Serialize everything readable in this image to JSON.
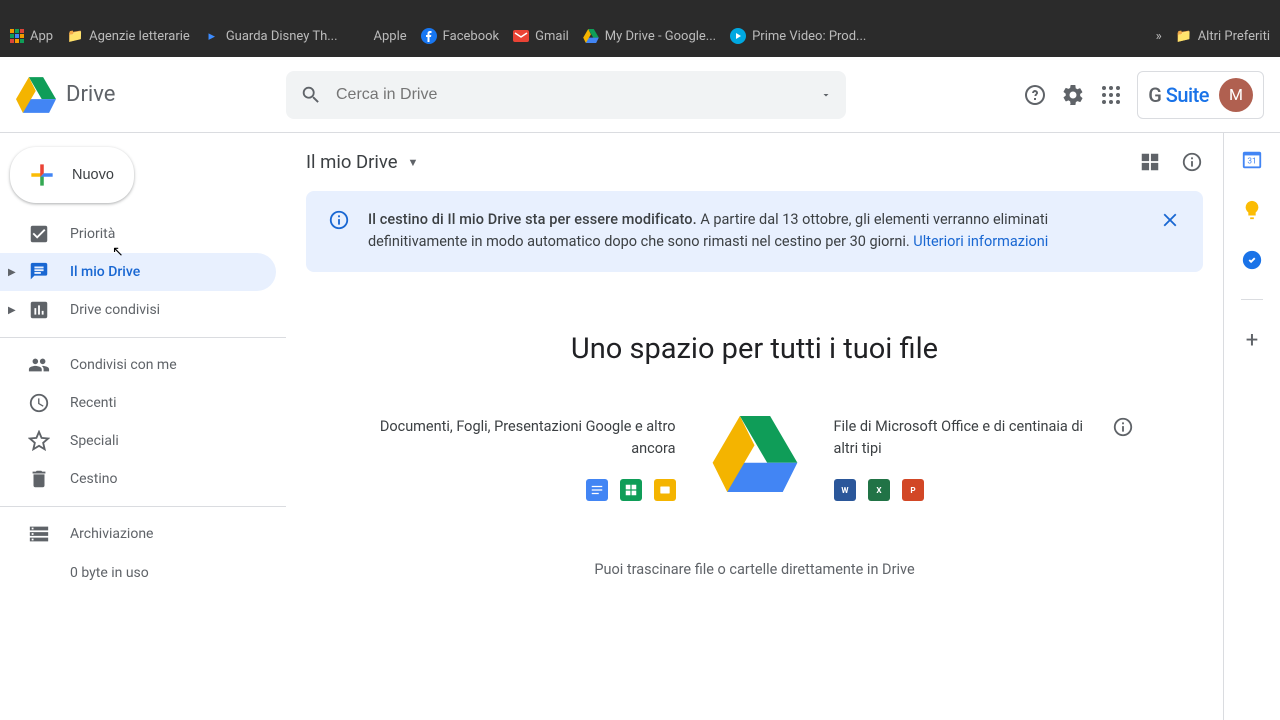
{
  "browser": {
    "bookmarks": [
      "App",
      "Agenzie letterarie",
      "Guarda Disney Th...",
      "Apple",
      "Facebook",
      "Gmail",
      "My Drive - Google...",
      "Prime Video: Prod..."
    ],
    "more": "»",
    "other": "Altri Preferiti"
  },
  "header": {
    "product": "Drive",
    "search_placeholder": "Cerca in Drive",
    "gsuite_g": "G",
    "gsuite_rest": " Suite",
    "avatar": "M"
  },
  "sidebar": {
    "new_label": "Nuovo",
    "items": {
      "priority": "Priorità",
      "mydrive": "Il mio Drive",
      "shared_drives": "Drive condivisi",
      "shared_with_me": "Condivisi con me",
      "recent": "Recenti",
      "starred": "Speciali",
      "trash": "Cestino",
      "storage": "Archiviazione"
    },
    "storage_used": "0 byte in uso"
  },
  "content": {
    "breadcrumb": "Il mio Drive",
    "banner": {
      "title": "Il cestino di Il mio Drive sta per essere modificato.",
      "body": " A partire dal 13 ottobre, gli elementi verranno eliminati definitivamente in modo automatico dopo che sono rimasti nel cestino per 30 giorni. ",
      "link": "Ulteriori informazioni"
    },
    "empty": {
      "headline": "Uno spazio per tutti i tuoi file",
      "left": "Documenti, Fogli, Presentazioni Google e altro ancora",
      "right": "File di Microsoft Office e di centinaia di altri tipi",
      "sub": "Puoi trascinare file o cartelle direttamente in Drive"
    }
  }
}
